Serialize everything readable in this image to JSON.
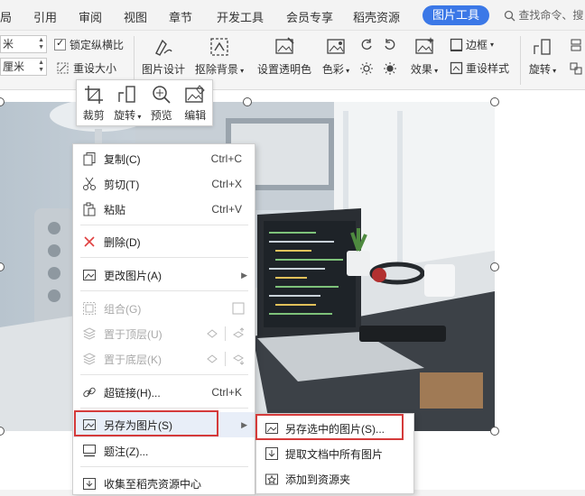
{
  "menubar": {
    "items": [
      "局",
      "引用",
      "审阅",
      "视图",
      "章节",
      "开发工具",
      "会员专享",
      "稻壳资源"
    ],
    "active_tab": "图片工具",
    "search_placeholder": "查找命令、搜"
  },
  "ribbon": {
    "width_value": "米",
    "height_value": "厘米",
    "lock_ratio_label": "锁定纵横比",
    "resize_label": "重设大小",
    "picture_design_label": "图片设计",
    "remove_bg_label": "抠除背景",
    "set_transparent_label": "设置透明色",
    "color_label": "色彩",
    "effect_label": "效果",
    "border_label": "边框",
    "reset_style_label": "重设样式",
    "rotate_label": "旋转"
  },
  "minibar": {
    "crop": "裁剪",
    "rotate": "旋转",
    "preview": "预览",
    "edit": "编辑"
  },
  "context_menu": {
    "copy": {
      "label": "复制(C)",
      "shortcut": "Ctrl+C"
    },
    "cut": {
      "label": "剪切(T)",
      "shortcut": "Ctrl+X"
    },
    "paste": {
      "label": "粘贴",
      "shortcut": "Ctrl+V"
    },
    "delete": {
      "label": "删除(D)"
    },
    "change_picture": {
      "label": "更改图片(A)"
    },
    "group": {
      "label": "组合(G)"
    },
    "bring_front": {
      "label": "置于顶层(U)"
    },
    "send_back": {
      "label": "置于底层(K)"
    },
    "hyperlink": {
      "label": "超链接(H)...",
      "shortcut": "Ctrl+K"
    },
    "save_as_picture": {
      "label": "另存为图片(S)"
    },
    "caption": {
      "label": "题注(Z)..."
    },
    "collect": {
      "label": "收集至稻壳资源中心"
    }
  },
  "submenu": {
    "save_selected": "另存选中的图片(S)...",
    "extract_all": "提取文档中所有图片",
    "add_to_folder": "添加到资源夹"
  },
  "colors": {
    "accent": "#3b78e7",
    "highlight_box": "#d43a3a",
    "delete_icon": "#e04040"
  }
}
